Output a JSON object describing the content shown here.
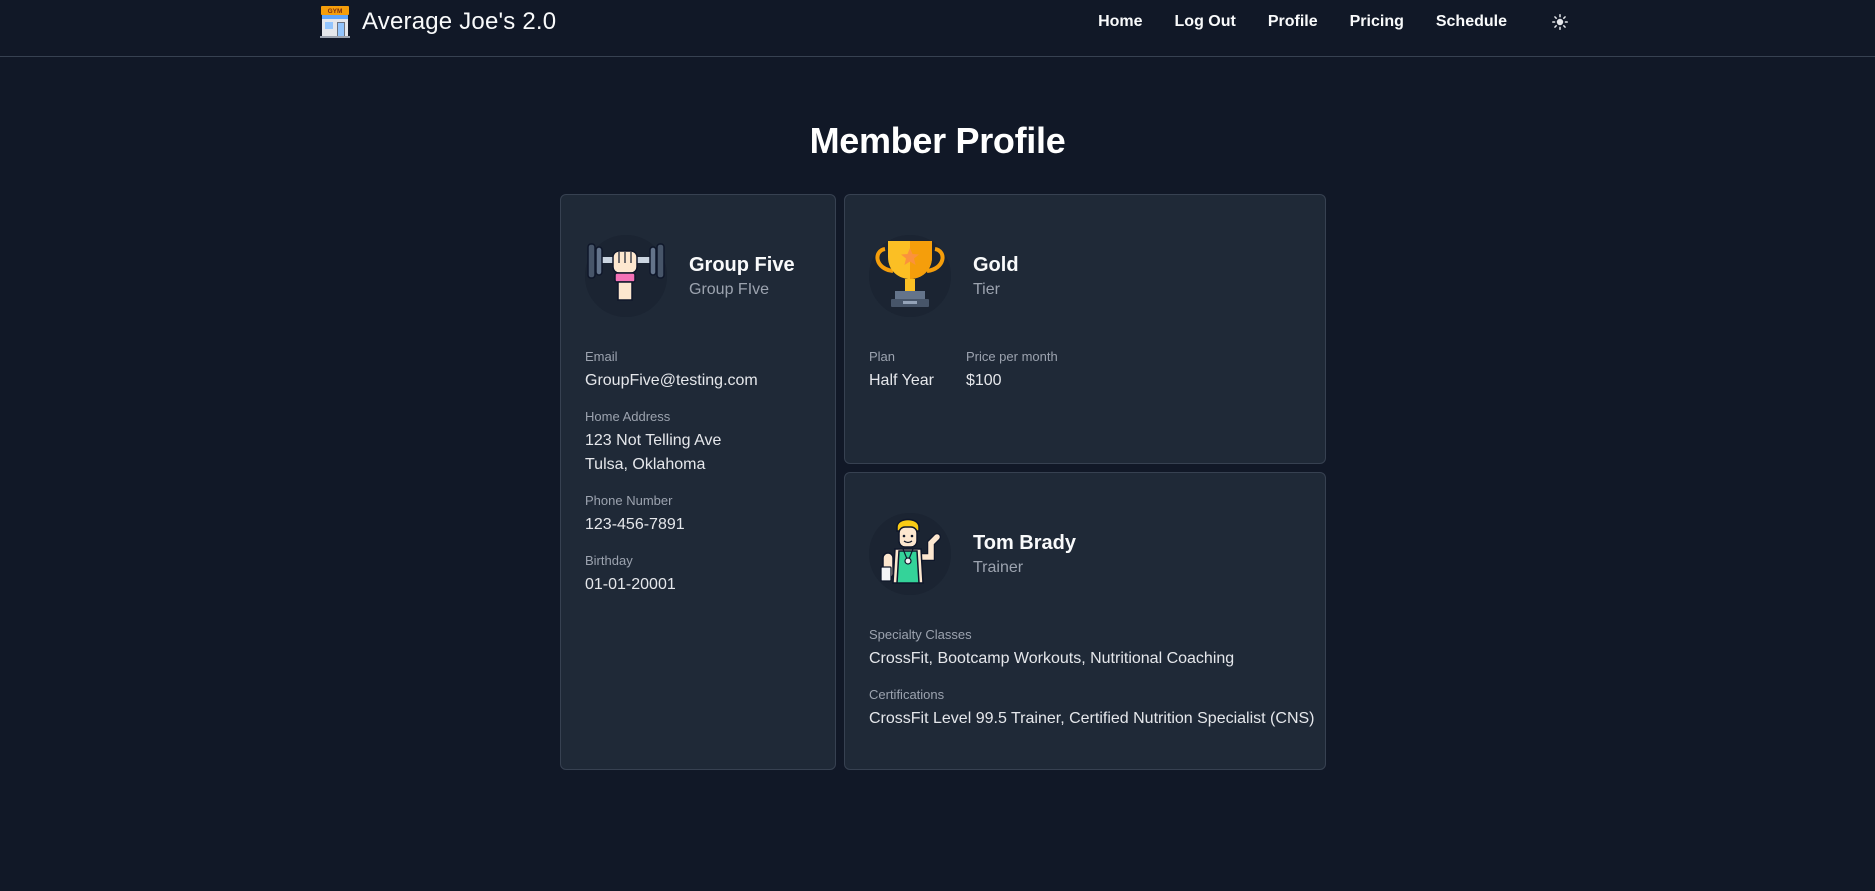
{
  "app": {
    "title": "Average Joe's 2.0",
    "logo_icon": "gym-storefront-icon",
    "logo_sign": "GYM"
  },
  "nav": {
    "items": [
      {
        "label": "Home"
      },
      {
        "label": "Log Out"
      },
      {
        "label": "Profile"
      },
      {
        "label": "Pricing"
      },
      {
        "label": "Schedule"
      }
    ],
    "theme_icon": "sun-icon"
  },
  "page": {
    "title": "Member Profile"
  },
  "member": {
    "avatar_icon": "dumbbell-lift-icon",
    "name": "Group Five",
    "subtitle": "Group FIve",
    "email_label": "Email",
    "email": "GroupFive@testing.com",
    "address_label": "Home Address",
    "address_line1": "123 Not Telling Ave",
    "address_line2": "Tulsa, Oklahoma",
    "phone_label": "Phone Number",
    "phone": "123-456-7891",
    "birthday_label": "Birthday",
    "birthday": "01-01-20001"
  },
  "tier": {
    "avatar_icon": "trophy-icon",
    "name": "Gold",
    "subtitle": "Tier",
    "plan_label": "Plan",
    "plan": "Half Year",
    "price_label": "Price per month",
    "price": "$100"
  },
  "trainer": {
    "avatar_icon": "trainer-flexing-icon",
    "name": "Tom Brady",
    "subtitle": "Trainer",
    "specialty_label": "Specialty Classes",
    "specialty": "CrossFit, Bootcamp Workouts, Nutritional Coaching",
    "certs_label": "Certifications",
    "certs": "CrossFit Level 99.5 Trainer, Certified Nutrition Specialist (CNS)"
  },
  "colors": {
    "background": "#111827",
    "card": "#1f2937",
    "border": "#374151",
    "muted_text": "#9ca3af"
  }
}
